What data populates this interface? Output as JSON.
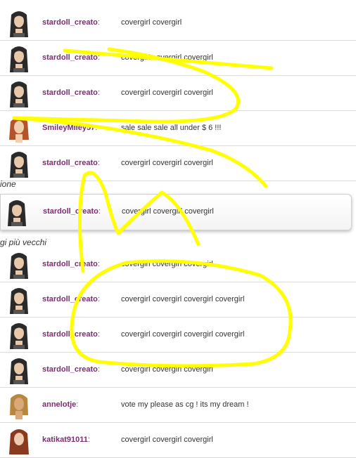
{
  "rows_top": [
    {
      "user": "stardoll_creato",
      "colon": ":",
      "message": "covergirl covergirl",
      "avatar": "dark-hair"
    },
    {
      "user": "stardoll_creato",
      "colon": ":",
      "message": "covergirl covergirl covergirl",
      "avatar": "dark-hair"
    },
    {
      "user": "stardoll_creato",
      "colon": ":",
      "message": "covergirl covergirl covergirl",
      "avatar": "dark-hair"
    },
    {
      "user": "SmileyMiley57",
      "colon": ":",
      "message": "sale sale sale all under $ 6 !!!",
      "avatar": "red-hair"
    },
    {
      "user": "stardoll_creato",
      "colon": ":",
      "message": "covergirl covergirl covergirl",
      "avatar": "dark-hair"
    }
  ],
  "section_1_label": "ione",
  "highlight_row": {
    "user": "stardoll_creato",
    "colon": ":",
    "message": "covergirl covergirl covergirl",
    "avatar": "dark-hair"
  },
  "section_2_label": "gi più vecchi",
  "rows_bottom": [
    {
      "user": "stardoll_creato",
      "colon": ":",
      "message": "covergirl covergirl covergirl",
      "avatar": "dark-hair"
    },
    {
      "user": "stardoll_creato",
      "colon": ":",
      "message": "covergirl covergirl covergirl covergirl",
      "avatar": "dark-hair"
    },
    {
      "user": "stardoll_creato",
      "colon": ":",
      "message": "covergirl covergirl covergirl covergirl",
      "avatar": "dark-hair"
    },
    {
      "user": "stardoll_creato",
      "colon": ":",
      "message": "covergirl covergirl covergirl",
      "avatar": "dark-hair"
    },
    {
      "user": "annelotje",
      "colon": ":",
      "message": "vote my please as cg ! its my dream !",
      "avatar": "blonde-hair"
    },
    {
      "user": "katikat91011",
      "colon": ":",
      "message": "covergirl covergirl covergirl",
      "avatar": "auburn-hair"
    }
  ],
  "colors": {
    "username": "#7b2d6f",
    "message": "#333333",
    "annotation": "#ffff00"
  }
}
